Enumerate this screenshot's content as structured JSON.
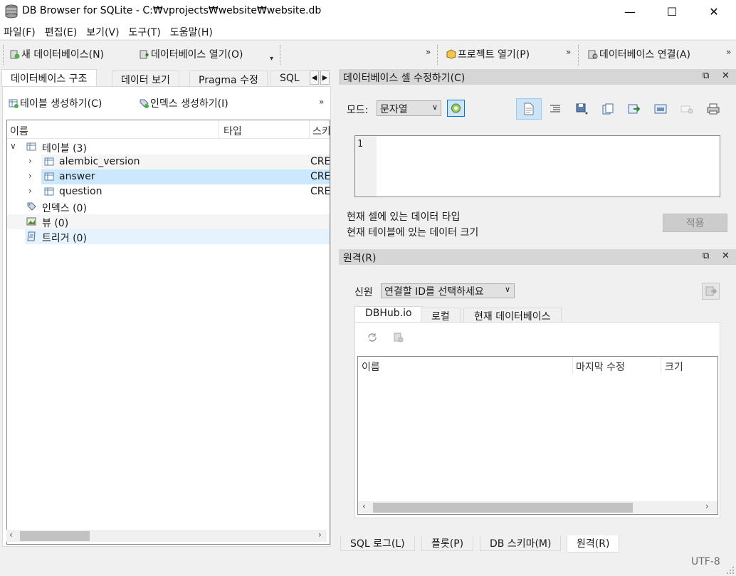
{
  "window": {
    "title": "DB Browser for SQLite - C:₩vprojects₩website₩website.db",
    "minimize": "—",
    "maximize": "☐",
    "close": "✕"
  },
  "menu": [
    "파일(F)",
    "편집(E)",
    "보기(V)",
    "도구(T)",
    "도움말(H)"
  ],
  "toolbar": {
    "new_db": "새 데이터베이스(N)",
    "open_db": "데이터베이스 열기(O)",
    "open_project": "프로젝트 열기(P)",
    "attach_db": "데이터베이스 연결(A)",
    "overflow": "»"
  },
  "left_tabs": [
    "데이터베이스 구조",
    "데이터 보기",
    "Pragma 수정",
    "SQL"
  ],
  "structure": {
    "create_table": "테이블 생성하기(C)",
    "create_index": "인덱스 생성하기(I)",
    "overflow": "»",
    "columns": [
      "이름",
      "타입",
      "스키"
    ],
    "tables_label": "테이블 (3)",
    "tables": [
      {
        "name": "alembic_version",
        "schema": "CRE"
      },
      {
        "name": "answer",
        "schema": "CRE"
      },
      {
        "name": "question",
        "schema": "CRE"
      }
    ],
    "indices_label": "인덱스 (0)",
    "views_label": "뷰 (0)",
    "triggers_label": "트리거 (0)"
  },
  "edit_cell": {
    "title": "데이터베이스 셀 수정하기(C)",
    "mode_label": "모드:",
    "mode_value": "문자열",
    "line_number": "1",
    "type_info": "현재 셀에 있는 데이터 타입",
    "size_info": "현재 테이블에 있는 데이터 크기",
    "apply": "적용"
  },
  "remote": {
    "title": "원격(R)",
    "identity_label": "신원",
    "identity_value": "연결할 ID를 선택하세요",
    "tabs": [
      "DBHub.io",
      "로컬",
      "현재 데이터베이스"
    ],
    "columns": [
      "이름",
      "마지막 수정",
      "크기"
    ]
  },
  "bottom_tabs": [
    "SQL 로그(L)",
    "플롯(P)",
    "DB 스키마(M)",
    "원격(R)"
  ],
  "status": {
    "encoding": "UTF-8"
  },
  "colors": {
    "accent": "#0078d7",
    "selection": "#cce8ff",
    "dock_title": "#d6d6d6"
  }
}
